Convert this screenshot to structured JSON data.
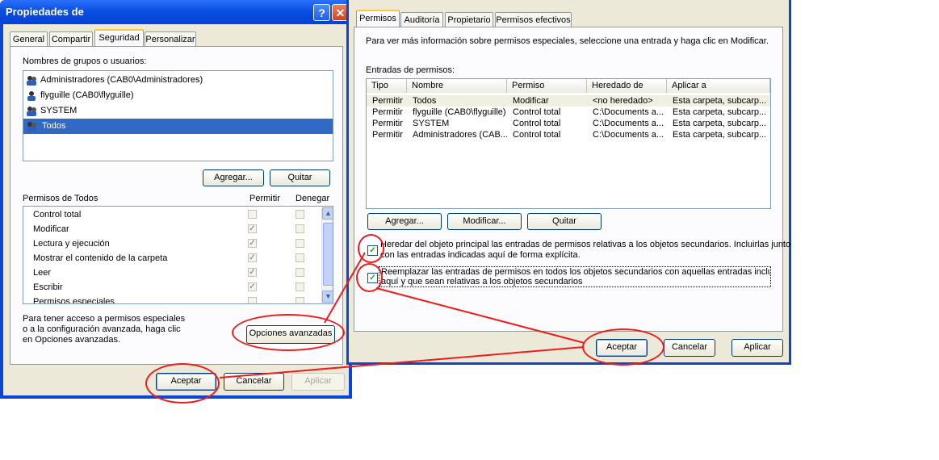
{
  "left_window": {
    "title": "Propiedades de",
    "tabs": [
      "General",
      "Compartir",
      "Seguridad",
      "Personalizar"
    ],
    "groups_label": "Nombres de grupos o usuarios:",
    "users": [
      {
        "name": "Administradores (CAB0\\Administradores)"
      },
      {
        "name": "flyguille (CAB0\\flyguille)"
      },
      {
        "name": "SYSTEM"
      },
      {
        "name": "Todos"
      }
    ],
    "add_button": "Agregar...",
    "remove_button": "Quitar",
    "permissions_label": "Permisos de Todos",
    "allow_header": "Permitir",
    "deny_header": "Denegar",
    "permissions": [
      {
        "name": "Control total",
        "allow": false,
        "deny": false
      },
      {
        "name": "Modificar",
        "allow": true,
        "deny": false
      },
      {
        "name": "Lectura y ejecución",
        "allow": true,
        "deny": false
      },
      {
        "name": "Mostrar el contenido de la carpeta",
        "allow": true,
        "deny": false
      },
      {
        "name": "Leer",
        "allow": true,
        "deny": false
      },
      {
        "name": "Escribir",
        "allow": true,
        "deny": false
      },
      {
        "name": "Permisos especiales",
        "allow": false,
        "deny": false
      }
    ],
    "help_text_1": "Para tener acceso a permisos especiales",
    "help_text_2": "o a la configuración avanzada, haga clic",
    "help_text_3": "en Opciones avanzadas.",
    "advanced_button": "Opciones avanzadas",
    "ok_button": "Aceptar",
    "cancel_button": "Cancelar",
    "apply_button": "Aplicar"
  },
  "right_window": {
    "tabs": [
      "Permisos",
      "Auditoría",
      "Propietario",
      "Permisos efectivos"
    ],
    "info_text": "Para ver más información sobre permisos especiales, seleccione una entrada y haga clic en Modificar.",
    "entries_label": "Entradas de permisos:",
    "columns": [
      "Tipo",
      "Nombre",
      "Permiso",
      "Heredado de",
      "Aplicar a"
    ],
    "rows": [
      [
        "Permitir",
        "Todos",
        "Modificar",
        "<no heredado>",
        "Esta carpeta, subcarp..."
      ],
      [
        "Permitir",
        "flyguille (CAB0\\flyguille)",
        "Control total",
        "C:\\Documents a...",
        "Esta carpeta, subcarp..."
      ],
      [
        "Permitir",
        "SYSTEM",
        "Control total",
        "C:\\Documents a...",
        "Esta carpeta, subcarp..."
      ],
      [
        "Permitir",
        "Administradores (CAB...",
        "Control total",
        "C:\\Documents a...",
        "Esta carpeta, subcarp..."
      ]
    ],
    "add_button": "Agregar...",
    "modify_button": "Modificar...",
    "remove_button": "Quitar",
    "inherit_line1": "Heredar del objeto principal las entradas de permisos relativas a los objetos secundarios. Incluirlas junto",
    "inherit_line2": "con las entradas indicadas aquí de forma explícita.",
    "replace_line1": "Reemplazar las entradas de permisos en todos los objetos secundarios con aquellas entradas incluidas",
    "replace_line2": "aquí y que sean relativas a los objetos secundarios",
    "ok_button": "Aceptar",
    "cancel_button": "Cancelar",
    "apply_button": "Aplicar"
  },
  "colors": {
    "annotation": "#ee1c1c",
    "xp_blue": "#0a45d6",
    "selection": "#316ac5",
    "dialog_bg": "#ece9d8"
  },
  "icons": [
    "help-icon",
    "close-icon",
    "user-group-icon",
    "scroll-up-icon",
    "scroll-down-icon",
    "checkmark-icon"
  ]
}
